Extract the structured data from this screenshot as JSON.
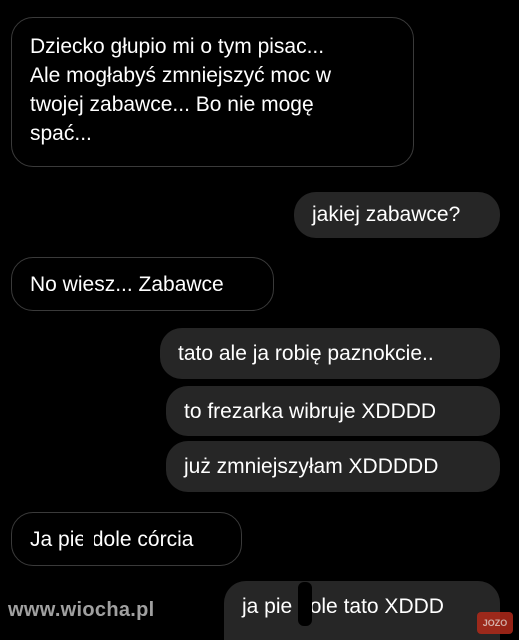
{
  "messages": [
    {
      "direction": "incoming",
      "text": "Dziecko głupio mi o tym pisac...\nAle mogłabyś zmniejszyć moc w\ntwojej zabawce... Bo nie mogę\nspać..."
    },
    {
      "direction": "outgoing",
      "text": "jakiej zabawce?"
    },
    {
      "direction": "incoming",
      "text": "No wiesz... Zabawce"
    },
    {
      "direction": "outgoing",
      "text": "tato ale ja robię paznokcie.."
    },
    {
      "direction": "outgoing",
      "text": "to frezarka wibruje XDDDD"
    },
    {
      "direction": "outgoing",
      "text": "już zmniejszyłam XDDDDD"
    },
    {
      "direction": "incoming",
      "text": "Ja pie   dole córcia"
    },
    {
      "direction": "outgoing",
      "text": "ja pie   dole tato XDDD"
    }
  ],
  "watermark": {
    "text": "www.wiocha.pl"
  },
  "badge": {
    "text": "JOZO"
  },
  "colors": {
    "background": "#000000",
    "incoming_border": "#3a3a3a",
    "outgoing_bubble": "#262626",
    "text": "#ffffff",
    "watermark": "#a0a0a0",
    "badge": "#b12a1a"
  }
}
